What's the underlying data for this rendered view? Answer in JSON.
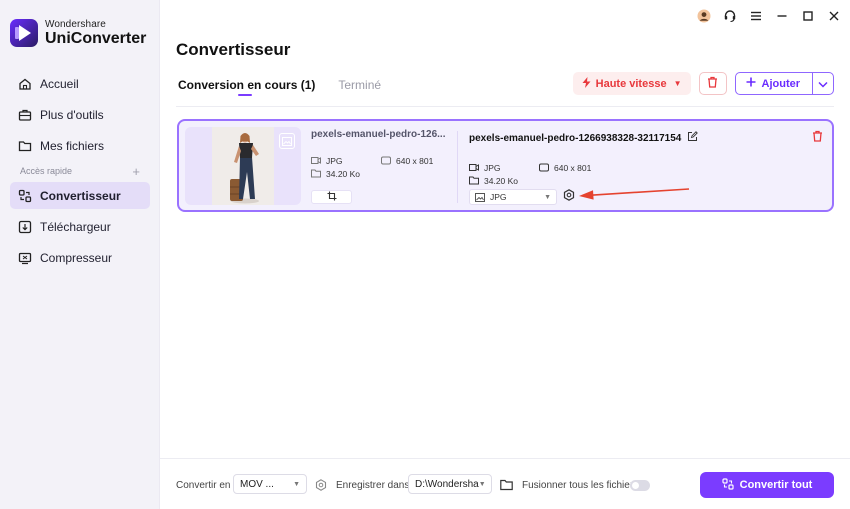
{
  "brand": {
    "line1": "Wondershare",
    "line2": "UniConverter"
  },
  "sidebar": {
    "items": [
      {
        "label": "Accueil",
        "icon": "home-icon"
      },
      {
        "label": "Plus d'outils",
        "icon": "toolbox-icon"
      },
      {
        "label": "Mes fichiers",
        "icon": "folder-icon"
      }
    ],
    "section_label": "Accès rapide",
    "quick_items": [
      {
        "label": "Convertisseur",
        "icon": "converter-icon",
        "active": true
      },
      {
        "label": "Téléchargeur",
        "icon": "download-icon"
      },
      {
        "label": "Compresseur",
        "icon": "compress-icon"
      }
    ]
  },
  "header": {
    "title": "Convertisseur"
  },
  "tabs": [
    {
      "label": "Conversion en cours (1)",
      "active": true
    },
    {
      "label": "Terminé",
      "active": false
    }
  ],
  "toolbar": {
    "speed_label": "Haute vitesse",
    "add_label": "Ajouter"
  },
  "file": {
    "source_name": "pexels-emanuel-pedro-126...",
    "source_format": "JPG",
    "source_resolution": "640 x 801",
    "source_size": "34.20 Ko",
    "output_name": "pexels-emanuel-pedro-1266938328-32117154",
    "output_format": "JPG",
    "output_resolution": "640 x 801",
    "output_size": "34.20 Ko",
    "format_select": "JPG"
  },
  "bottom": {
    "convert_to_label": "Convertir en",
    "convert_to_value": "MOV ...",
    "save_in_label": "Enregistrer dans",
    "save_in_value": "D:\\Wondersha",
    "merge_label": "Fusionner tous les fichiers",
    "convert_all_label": "Convertir tout"
  },
  "colors": {
    "accent": "#7b3cff",
    "danger": "#e8383c",
    "active_nav": "#e4ddf8"
  }
}
